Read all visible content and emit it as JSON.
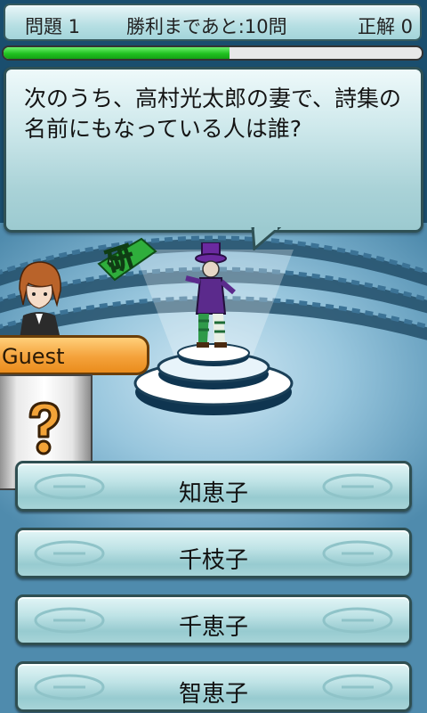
{
  "header": {
    "question_label": "問題 1",
    "remaining_label": "勝利まであと:10問",
    "correct_label": "正解 0"
  },
  "timer": {
    "remaining_fraction": 0.54
  },
  "question": {
    "text": "次のうち、高村光太郎の妻で、詩集の名前にもなっている人は誰?"
  },
  "host_badge": {
    "text": "研"
  },
  "player": {
    "name": "Guest",
    "answer_status_icon": "question-mark-icon"
  },
  "choices": [
    {
      "label": "知恵子"
    },
    {
      "label": "千枝子"
    },
    {
      "label": "千恵子"
    },
    {
      "label": "智恵子"
    }
  ],
  "colors": {
    "timer_fill": "#21c221",
    "name_tag": "#f4a23b",
    "button_face": "#bfe3e6"
  }
}
